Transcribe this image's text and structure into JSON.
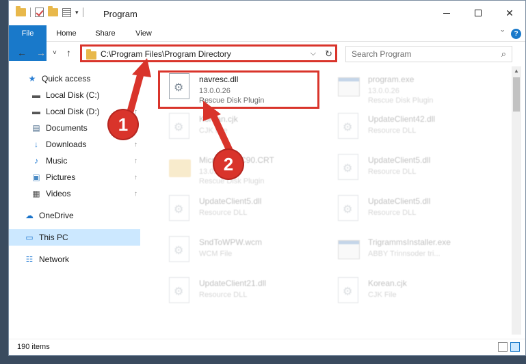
{
  "window": {
    "title": "Program",
    "controls": {
      "minimize": "",
      "maximize": "",
      "close": "✕"
    }
  },
  "ribbon": {
    "tabs": [
      "File",
      "Home",
      "Share",
      "View"
    ],
    "expand_icon": "ˇ",
    "help": "?"
  },
  "address": {
    "path": "C:\\Program Files\\Program Directory",
    "dropdown": "⌵",
    "refresh": "↻"
  },
  "search": {
    "placeholder": "Search Program",
    "icon": "⌕"
  },
  "nav": {
    "back": "←",
    "forward": "→",
    "recent": "˅",
    "up": "↑"
  },
  "sidebar": {
    "items": [
      {
        "label": "Quick access",
        "icon": "star-icon",
        "glyph": "★",
        "color": "#2a7fd4",
        "pinned": false
      },
      {
        "label": "Local Disk (C:)",
        "icon": "drive-icon",
        "glyph": "▬",
        "color": "#555555",
        "pinned": true
      },
      {
        "label": "Local Disk (D:)",
        "icon": "drive-icon",
        "glyph": "▬",
        "color": "#555555",
        "pinned": true
      },
      {
        "label": "Documents",
        "icon": "documents-icon",
        "glyph": "▤",
        "color": "#4a6b8a",
        "pinned": true
      },
      {
        "label": "Downloads",
        "icon": "download-icon",
        "glyph": "↓",
        "color": "#2a7fd4",
        "pinned": true
      },
      {
        "label": "Music",
        "icon": "music-icon",
        "glyph": "♪",
        "color": "#2a7fd4",
        "pinned": true
      },
      {
        "label": "Pictures",
        "icon": "pictures-icon",
        "glyph": "▣",
        "color": "#4a8ac4",
        "pinned": true
      },
      {
        "label": "Videos",
        "icon": "video-icon",
        "glyph": "▦",
        "color": "#555555",
        "pinned": true
      },
      {
        "label": "OneDrive",
        "icon": "cloud-icon",
        "glyph": "☁",
        "color": "#1a73c9",
        "pinned": false
      },
      {
        "label": "This PC",
        "icon": "pc-icon",
        "glyph": "▭",
        "color": "#2a7fd4",
        "pinned": false
      },
      {
        "label": "Network",
        "icon": "network-icon",
        "glyph": "☷",
        "color": "#2a7fd4",
        "pinned": false
      }
    ],
    "pin_glyph": "↑"
  },
  "files": [
    {
      "name": "navresc.dll",
      "line1": "13.0.0.26",
      "line2": "Rescue Disk Plugin",
      "kind": "dll",
      "highlighted": true
    },
    {
      "name": "program.exe",
      "line1": "13.0.0.26",
      "line2": "Rescue Disk Plugin",
      "kind": "exe"
    },
    {
      "name": "Korean.cjk",
      "line1": "CJK File",
      "line2": "",
      "kind": "dll"
    },
    {
      "name": "UpdateClient42.dll",
      "line1": "Resource DLL",
      "line2": "",
      "kind": "dll"
    },
    {
      "name": "Microsoft.VC90.CRT",
      "line1": "13.0.0.26",
      "line2": "Rescue Disk Plugin",
      "kind": "folder"
    },
    {
      "name": "UpdateClient5.dll",
      "line1": "Resource DLL",
      "line2": "",
      "kind": "dll"
    },
    {
      "name": "UpdateClient5.dll",
      "line1": "Resource DLL",
      "line2": "",
      "kind": "dll"
    },
    {
      "name": "UpdateClient5.dll",
      "line1": "Resource DLL",
      "line2": "",
      "kind": "dll"
    },
    {
      "name": "SndToWPW.wcm",
      "line1": "WCM File",
      "line2": "",
      "kind": "dll"
    },
    {
      "name": "TrigrammsInstaller.exe",
      "line1": "ABBY Trinnsoder tri...",
      "line2": "",
      "kind": "exe"
    },
    {
      "name": "UpdateClient21.dll",
      "line1": "Resource DLL",
      "line2": "",
      "kind": "dll"
    },
    {
      "name": "Korean.cjk",
      "line1": "CJK File",
      "line2": "",
      "kind": "dll"
    }
  ],
  "status": {
    "item_count": "190 items"
  },
  "callouts": {
    "one": "1",
    "two": "2",
    "color": "#d9342b"
  }
}
